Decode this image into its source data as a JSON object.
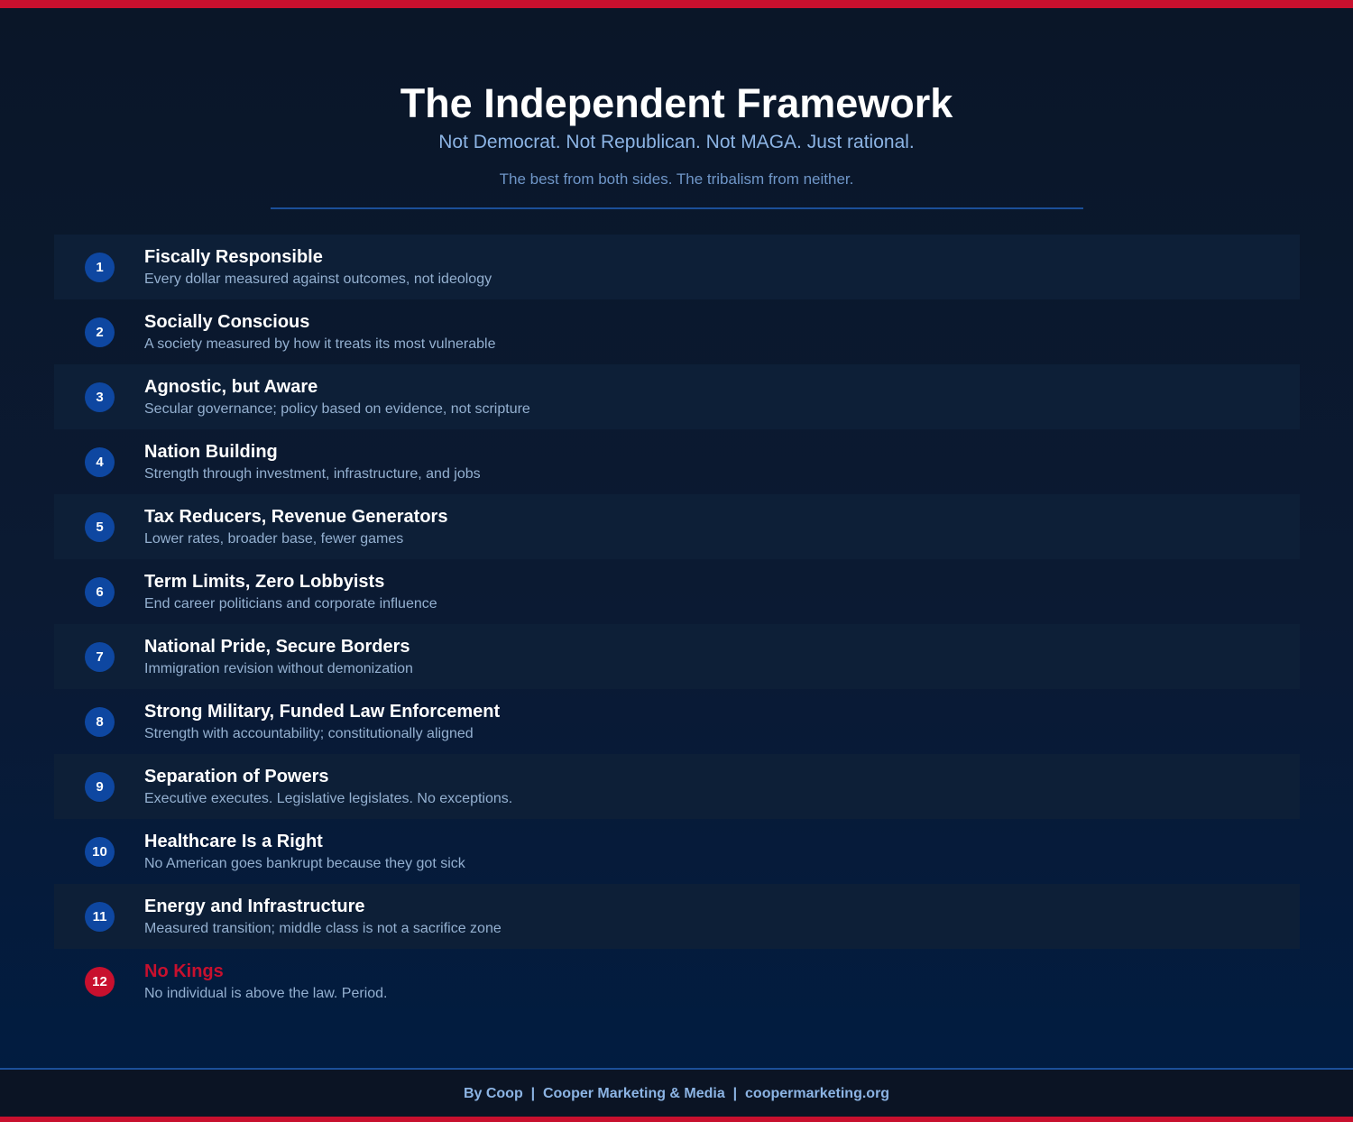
{
  "header": {
    "title": "The Independent Framework",
    "subtitle": "Not Democrat. Not Republican. Not MAGA. Just rational.",
    "tagline": "The best from both sides. The tribalism from neither."
  },
  "items": [
    {
      "number": "1",
      "title": "Fiscally Responsible",
      "description": "Every dollar measured against outcomes, not ideology"
    },
    {
      "number": "2",
      "title": "Socially Conscious",
      "description": "A society measured by how it treats its most vulnerable"
    },
    {
      "number": "3",
      "title": "Agnostic, but Aware",
      "description": "Secular governance; policy based on evidence, not scripture"
    },
    {
      "number": "4",
      "title": "Nation Building",
      "description": "Strength through investment, infrastructure, and jobs"
    },
    {
      "number": "5",
      "title": "Tax Reducers, Revenue Generators",
      "description": "Lower rates, broader base, fewer games"
    },
    {
      "number": "6",
      "title": "Term Limits, Zero Lobbyists",
      "description": "End career politicians and corporate influence"
    },
    {
      "number": "7",
      "title": "National Pride, Secure Borders",
      "description": "Immigration revision without demonization"
    },
    {
      "number": "8",
      "title": "Strong Military, Funded Law Enforcement",
      "description": "Strength with accountability; constitutionally aligned"
    },
    {
      "number": "9",
      "title": "Separation of Powers",
      "description": "Executive executes. Legislative legislates. No exceptions."
    },
    {
      "number": "10",
      "title": "Healthcare Is a Right",
      "description": "No American goes bankrupt because they got sick"
    },
    {
      "number": "11",
      "title": "Energy and Infrastructure",
      "description": "Measured transition; middle class is not a sacrifice zone"
    },
    {
      "number": "12",
      "title": "No Kings",
      "description": "No individual is above the law. Period."
    }
  ],
  "footer": {
    "text": "By Coop  |  Cooper Marketing & Media  |  coopermarketing.org"
  },
  "colors": {
    "accent_red": "#c8102e",
    "badge_blue": "#0e47a1",
    "background": "#0a1628",
    "subtitle_blue": "#8cb4e4"
  }
}
